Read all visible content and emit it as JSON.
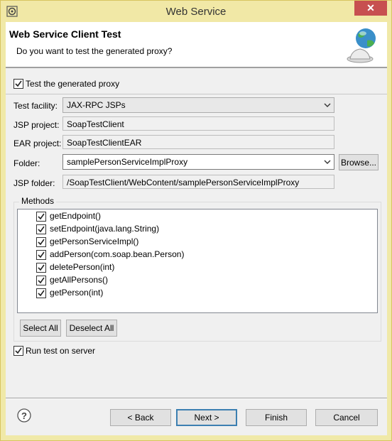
{
  "window": {
    "title": "Web Service",
    "close_glyph": "✕"
  },
  "header": {
    "title": "Web Service Client Test",
    "subtitle": "Do you want to test the generated proxy?",
    "icon": "globe-service-icon"
  },
  "test_proxy": {
    "label": "Test the generated proxy",
    "checked": true
  },
  "form": {
    "test_facility": {
      "label": "Test facility:",
      "value": "JAX-RPC JSPs"
    },
    "jsp_project": {
      "label": "JSP project:",
      "value": "SoapTestClient"
    },
    "ear_project": {
      "label": "EAR project:",
      "value": "SoapTestClientEAR"
    },
    "folder": {
      "label": "Folder:",
      "value": "samplePersonServiceImplProxy",
      "browse_label": "Browse..."
    },
    "jsp_folder": {
      "label": "JSP folder:",
      "value": "/SoapTestClient/WebContent/samplePersonServiceImplProxy"
    }
  },
  "methods": {
    "group_label": "Methods",
    "items": [
      {
        "label": "getEndpoint()",
        "checked": true
      },
      {
        "label": "setEndpoint(java.lang.String)",
        "checked": true
      },
      {
        "label": "getPersonServiceImpl()",
        "checked": true
      },
      {
        "label": "addPerson(com.soap.bean.Person)",
        "checked": true
      },
      {
        "label": "deletePerson(int)",
        "checked": true
      },
      {
        "label": "getAllPersons()",
        "checked": true
      },
      {
        "label": "getPerson(int)",
        "checked": true
      }
    ],
    "select_all_label": "Select All",
    "deselect_all_label": "Deselect All"
  },
  "run_on_server": {
    "label": "Run test on server",
    "checked": true
  },
  "footer": {
    "back_label": "< Back",
    "next_label": "Next >",
    "finish_label": "Finish",
    "cancel_label": "Cancel"
  }
}
